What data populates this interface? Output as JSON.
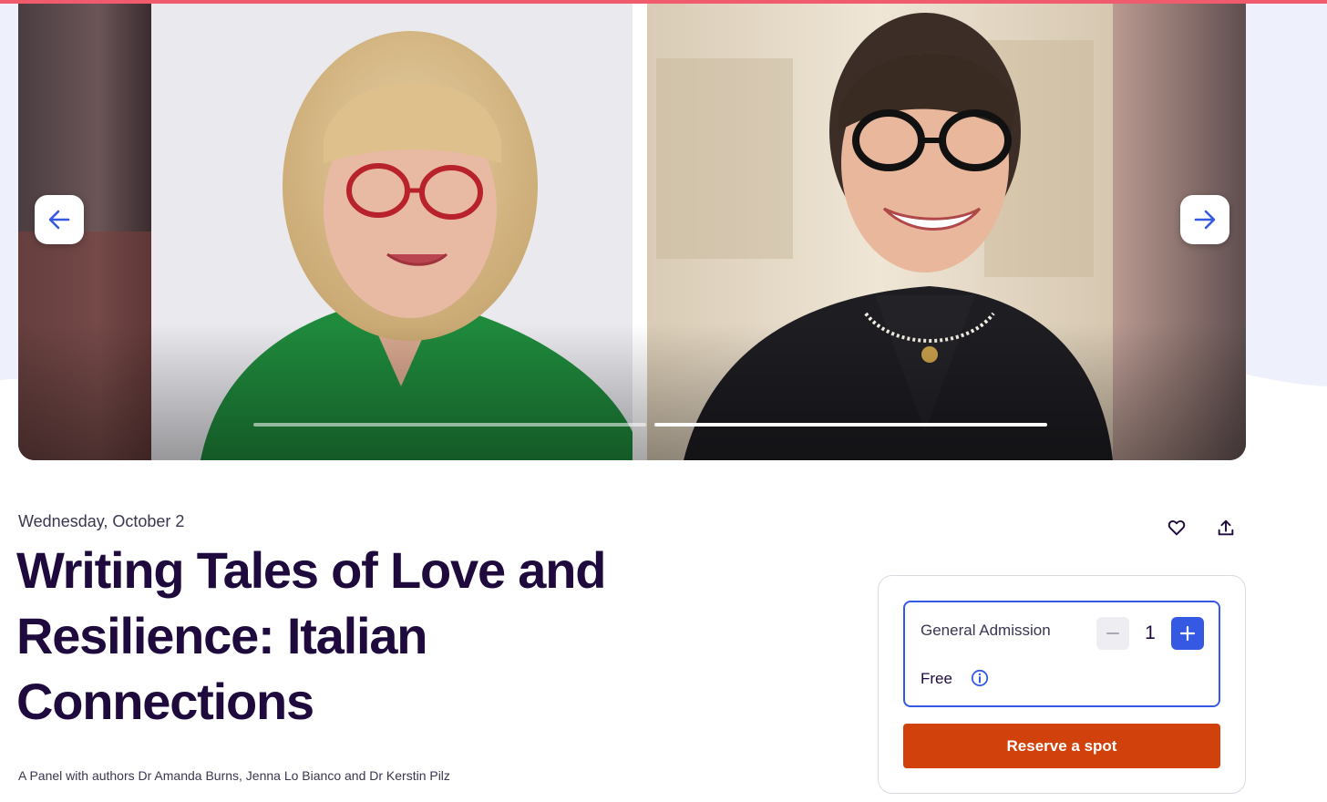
{
  "carousel": {
    "prev_icon": "arrow-left-icon",
    "next_icon": "arrow-right-icon",
    "slides": [
      {
        "subject": "author-portrait-green-shirt"
      },
      {
        "subject": "author-portrait-dark-blazer"
      }
    ],
    "active_slide": 2
  },
  "event": {
    "date": "Wednesday, October 2",
    "title_lines": [
      "Writing Tales of Love and",
      "Resilience: Italian",
      "Connections"
    ],
    "summary": "A Panel with authors Dr Amanda Burns, Jenna Lo Bianco and Dr Kerstin Pilz"
  },
  "actions": {
    "like_icon": "heart-icon",
    "share_icon": "share-upload-icon"
  },
  "ticket": {
    "name": "General Admission",
    "price": "Free",
    "quantity": "1",
    "minus_icon": "minus-icon",
    "plus_icon": "plus-icon",
    "info_icon": "info-icon",
    "reserve_label": "Reserve a spot"
  },
  "colors": {
    "accent_blue": "#3659e3",
    "reserve_orange": "#d1410c",
    "title_ink": "#1e0a3c",
    "top_strip": "#f05b6e"
  }
}
